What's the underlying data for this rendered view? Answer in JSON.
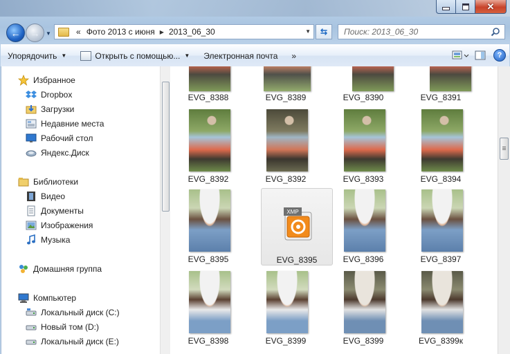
{
  "window": {
    "close_glyph": "✕"
  },
  "address": {
    "overflow": "«",
    "crumbs": [
      "Фото 2013 с июня",
      "2013_06_30"
    ]
  },
  "search": {
    "placeholder": "Поиск: 2013_06_30"
  },
  "toolbar": {
    "organize": "Упорядочить",
    "open_with": "Открыть с помощью...",
    "email": "Электронная почта",
    "more": "»"
  },
  "nav": {
    "favorites": "Избранное",
    "dropbox": "Dropbox",
    "downloads": "Загрузки",
    "recent": "Недавние места",
    "desktop": "Рабочий стол",
    "yadisk": "Яндекс.Диск",
    "libraries": "Библиотеки",
    "video": "Видео",
    "documents": "Документы",
    "images": "Изображения",
    "music": "Музыка",
    "homegroup": "Домашняя группа",
    "computer": "Компьютер",
    "disk_c": "Локальный диск (C:)",
    "disk_d": "Новый том (D:)",
    "disk_e": "Локальный диск (E:)"
  },
  "files": {
    "row1": [
      "EVG_8388",
      "EVG_8389",
      "EVG_8390",
      "EVG_8391"
    ],
    "row2": [
      "EVG_8392",
      "EVG_8392",
      "EVG_8393",
      "EVG_8394"
    ],
    "row3": [
      "EVG_8395",
      "EVG_8395",
      "EVG_8396",
      "EVG_8397"
    ],
    "row4": [
      "EVG_8398",
      "EVG_8399",
      "EVG_8399",
      "EVG_8399к"
    ],
    "xmp_label": "XMP"
  },
  "colors": {
    "accent": "#1f63c4",
    "selection": "#e7e7e7"
  }
}
